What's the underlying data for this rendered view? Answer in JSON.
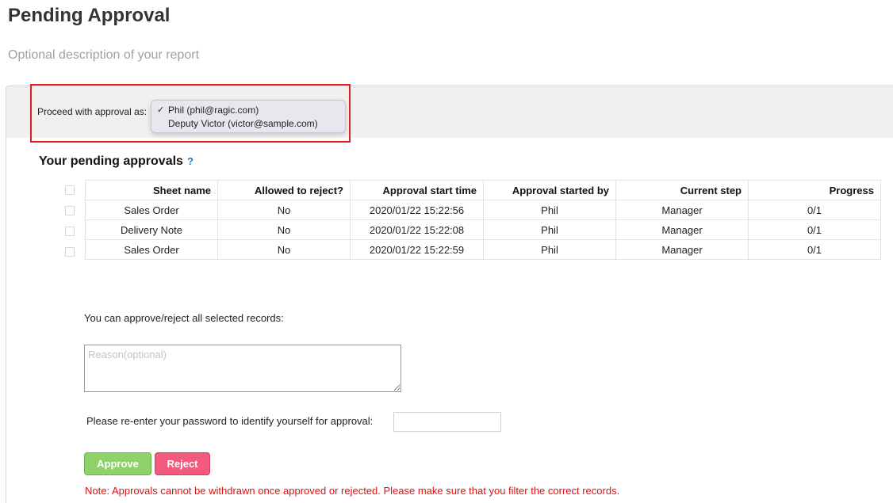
{
  "header": {
    "title": "Pending Approval",
    "description": "Optional description of your report"
  },
  "proceed": {
    "label": "Proceed with approval as:",
    "options": [
      "Phil (phil@ragic.com)",
      "Deputy Victor (victor@sample.com)"
    ],
    "selected_index": 0,
    "checkmark": "✓"
  },
  "pending": {
    "title": "Your pending approvals",
    "help": "?",
    "columns": [
      "Sheet name",
      "Allowed to reject?",
      "Approval start time",
      "Approval started by",
      "Current step",
      "Progress"
    ],
    "rows": [
      [
        "Sales Order",
        "No",
        "2020/01/22 15:22:56",
        "Phil",
        "Manager",
        "0/1"
      ],
      [
        "Delivery Note",
        "No",
        "2020/01/22 15:22:08",
        "Phil",
        "Manager",
        "0/1"
      ],
      [
        "Sales Order",
        "No",
        "2020/01/22 15:22:59",
        "Phil",
        "Manager",
        "0/1"
      ]
    ]
  },
  "bulk": {
    "label": "You can approve/reject all selected records:",
    "reason_placeholder": "Reason(optional)",
    "password_label": "Please re-enter your password to identify yourself for approval:",
    "approve_label": "Approve",
    "reject_label": "Reject",
    "note": "Note: Approvals cannot be withdrawn once approved or rejected. Please make sure that you filter the correct records."
  },
  "colors": {
    "highlight": "#e02020",
    "approve": "#8fd16a",
    "reject": "#f25b7e",
    "note": "#e01010",
    "help": "#1a7fd6"
  }
}
